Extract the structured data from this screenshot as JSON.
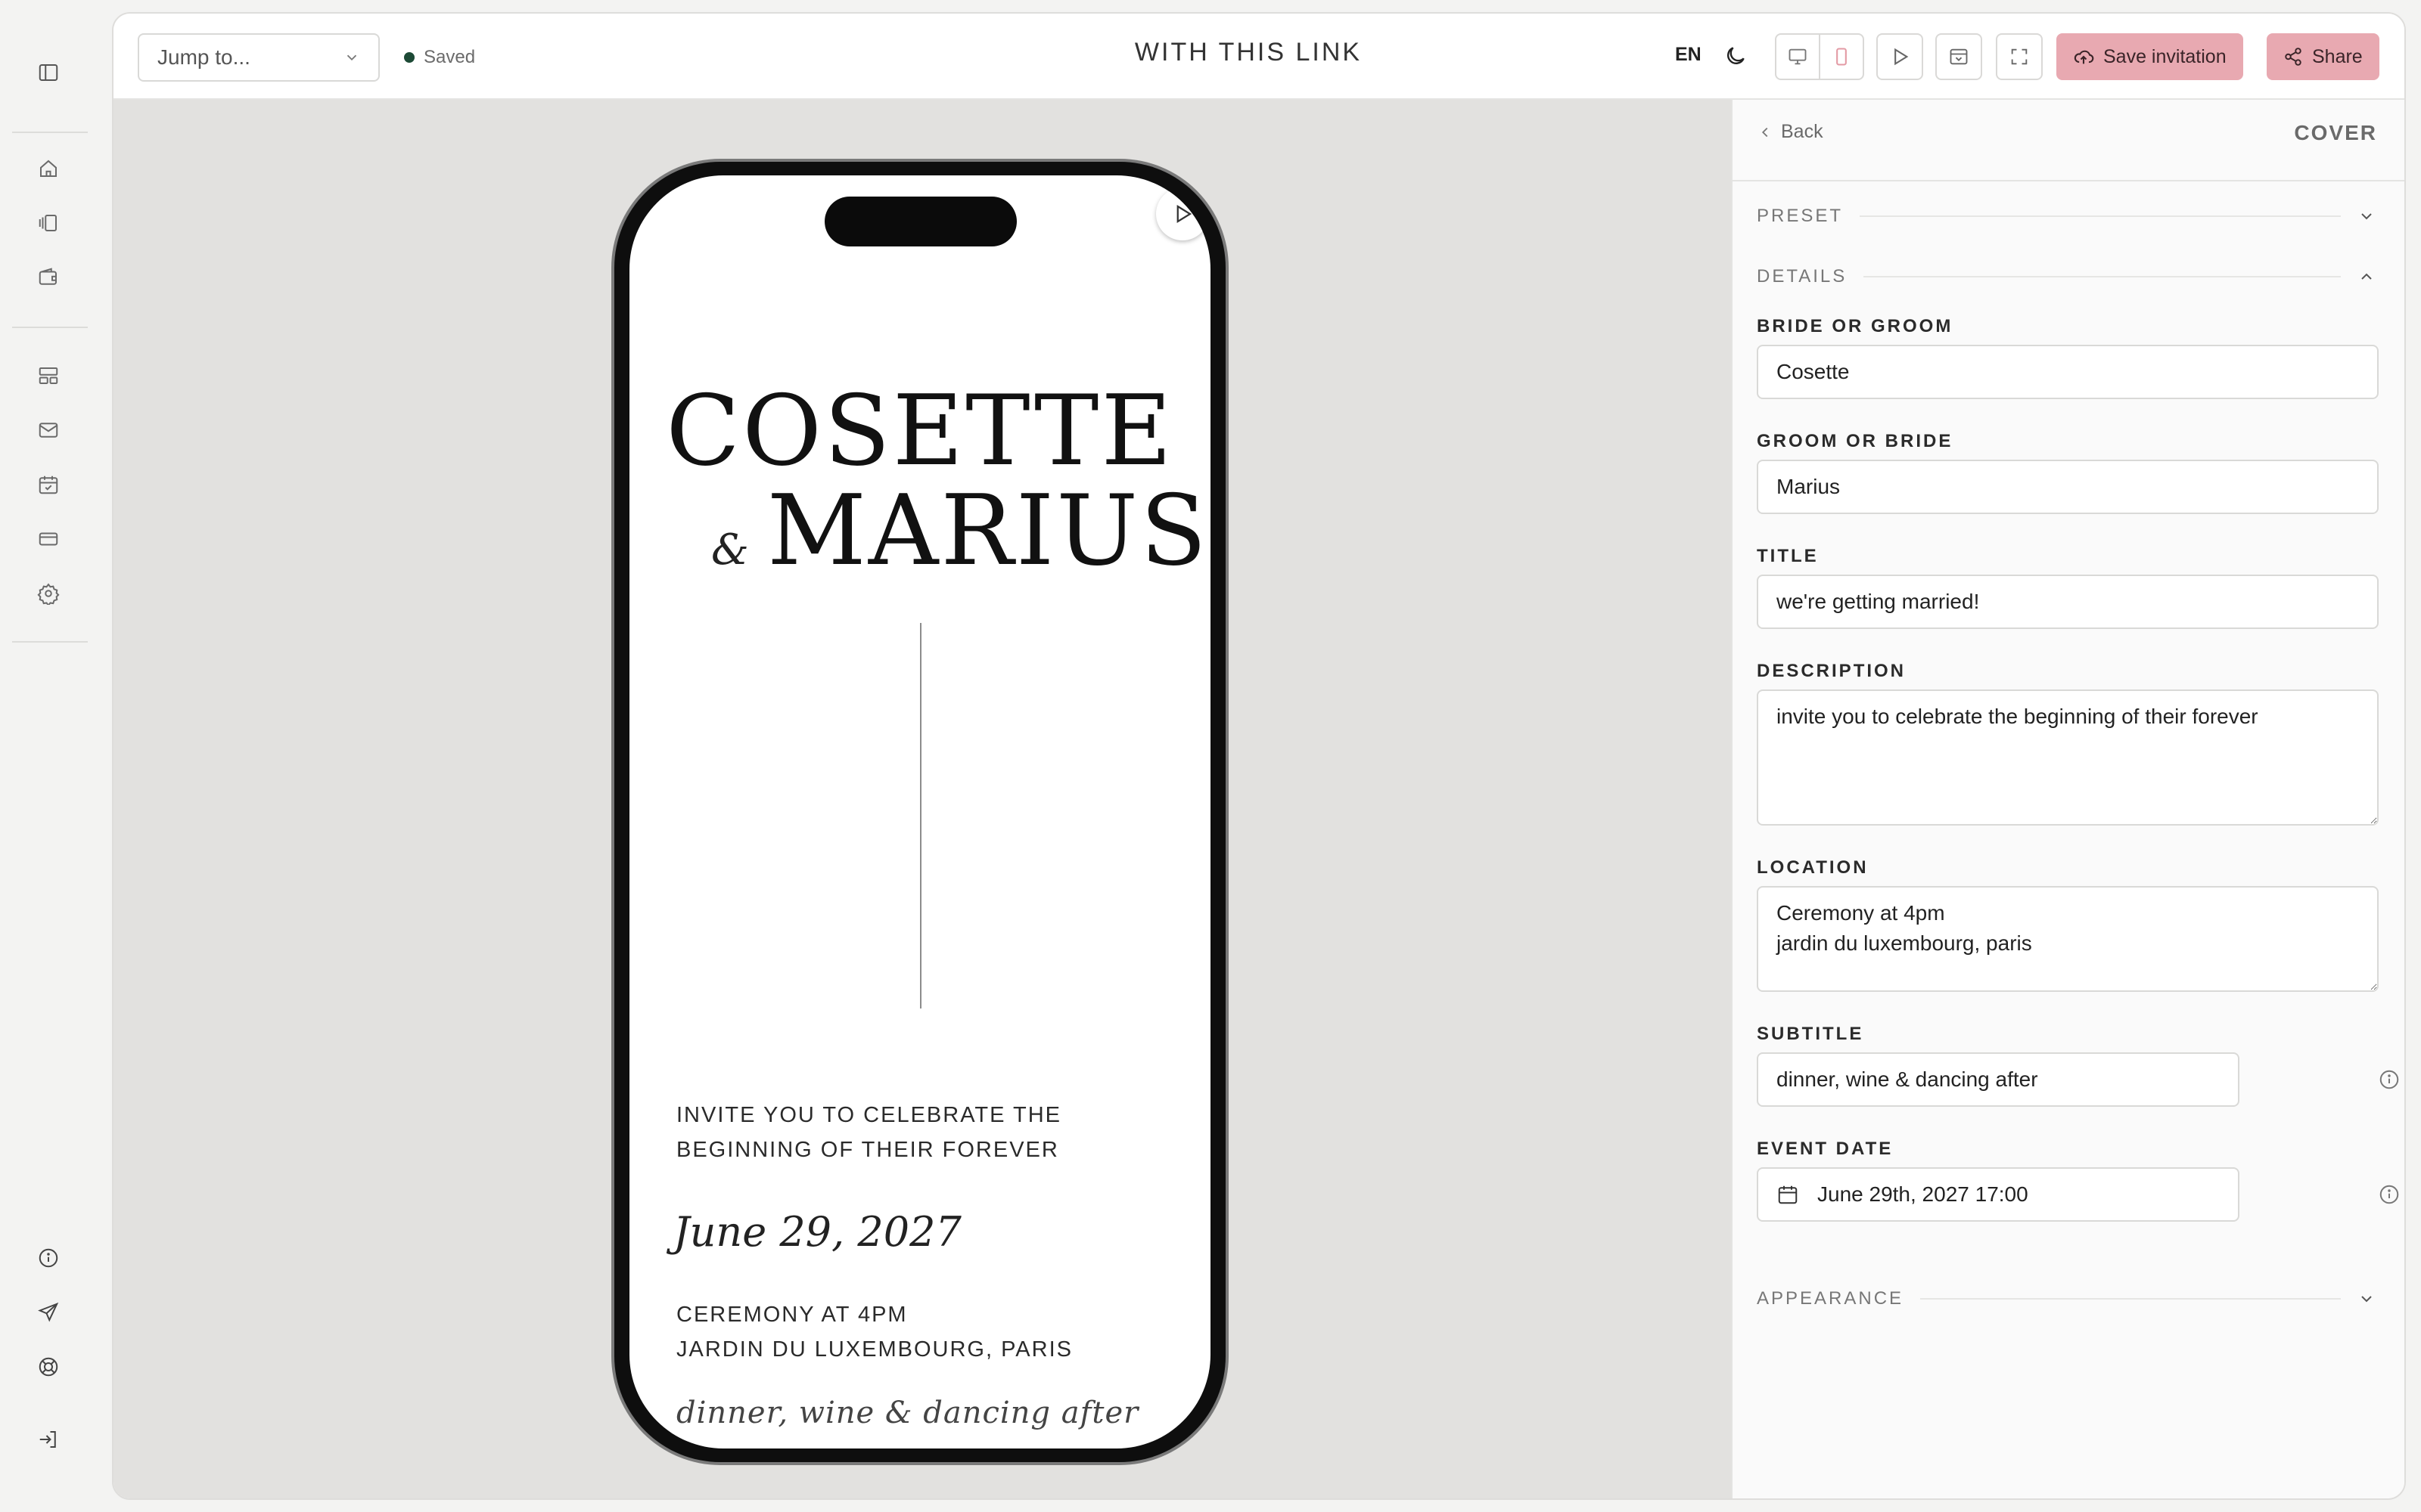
{
  "topbar": {
    "jump_placeholder": "Jump to...",
    "status": "Saved",
    "page_title": "WITH THIS LINK",
    "language": "EN",
    "save_label": "Save invitation",
    "share_label": "Share"
  },
  "rail": {
    "top_icons": [
      "sidebar-toggle-icon",
      "home-icon",
      "pages-icon",
      "wallet-icon"
    ],
    "mid_icons": [
      "layout-icon",
      "mail-icon",
      "calendar-check-icon",
      "card-icon",
      "settings-icon"
    ],
    "bottom_icons": [
      "info-icon",
      "send-icon",
      "lifebuoy-icon",
      "logout-icon"
    ]
  },
  "invitation": {
    "name1": "COSETTE",
    "amp": "&",
    "name2": "MARIUS",
    "description": "invite you to celebrate the beginning of their forever",
    "date": "June 29, 2027",
    "location_line1": "Ceremony at 4pm",
    "location_line2": "jardin du luxembourg, paris",
    "subtitle": "dinner, wine & dancing after"
  },
  "panel": {
    "back_label": "Back",
    "section_title": "COVER",
    "sections": {
      "preset": "PRESET",
      "details": "DETAILS",
      "appearance": "APPEARANCE"
    },
    "fields": {
      "bride_label": "BRIDE OR GROOM",
      "bride_value": "Cosette",
      "groom_label": "GROOM OR BRIDE",
      "groom_value": "Marius",
      "title_label": "TITLE",
      "title_value": "we're getting married!",
      "description_label": "DESCRIPTION",
      "description_value": "invite you to celebrate the beginning of their forever",
      "location_label": "LOCATION",
      "location_value": "Ceremony at 4pm\njardin du luxembourg, paris",
      "subtitle_label": "SUBTITLE",
      "subtitle_value": "dinner, wine & dancing after",
      "subtitle_enabled": true,
      "event_date_label": "EVENT DATE",
      "event_date_value": "June 29th, 2027 17:00",
      "event_date_enabled": true
    }
  },
  "colors": {
    "accent_pink": "#e8a9b1",
    "status_green": "#1d4a36",
    "canvas_bg": "#e2e1df"
  }
}
